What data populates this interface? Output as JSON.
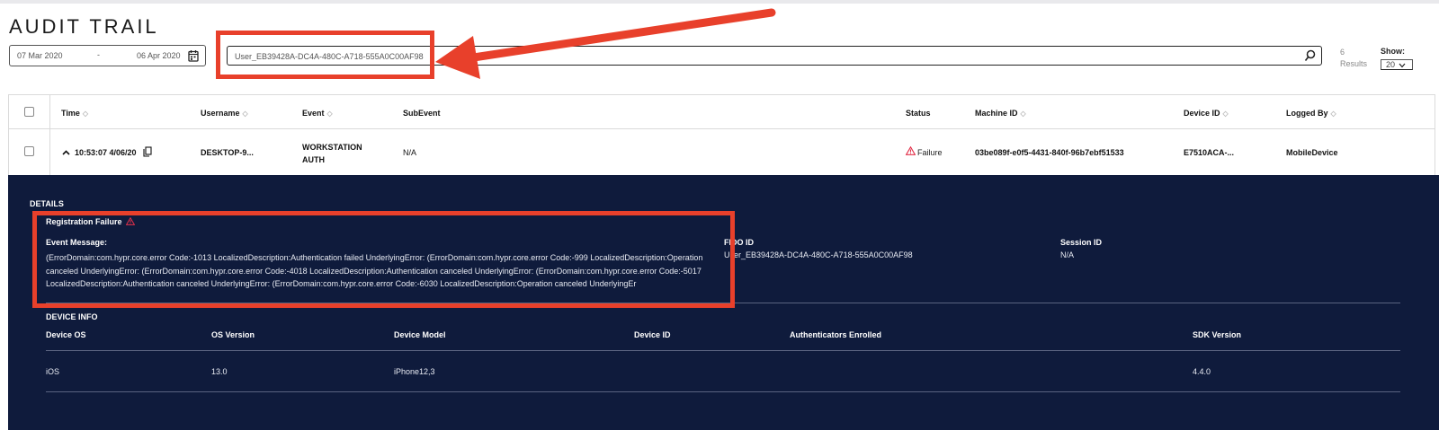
{
  "header": {
    "title": "AUDIT TRAIL"
  },
  "filters": {
    "date_start": "07 Mar 2020",
    "date_separator": "-",
    "date_end": "06 Apr 2020",
    "search_value": "User_EB39428A-DC4A-480C-A718-555A0C00AF98",
    "results_count": "6",
    "results_label": "Results",
    "show_label": "Show:",
    "show_value": "20"
  },
  "table": {
    "columns": [
      "Time",
      "Username",
      "Event",
      "SubEvent",
      "Status",
      "Machine ID",
      "Device ID",
      "Logged By"
    ],
    "row": {
      "time": "10:53:07 4/06/20",
      "username": "DESKTOP-9...",
      "event_line1": "WORKSTATION",
      "event_line2": "AUTH",
      "subevent": "N/A",
      "status": "Failure",
      "machine_id": "03be089f-e0f5-4431-840f-96b7ebf51533",
      "device_id": "E7510ACA-...",
      "logged_by": "MobileDevice"
    }
  },
  "details": {
    "section_title": "DETAILS",
    "failure_title": "Registration Failure",
    "event_message_label": "Event Message:",
    "event_message": "(ErrorDomain:com.hypr.core.error Code:-1013 LocalizedDescription:Authentication failed UnderlyingError: (ErrorDomain:com.hypr.core.error Code:-999 LocalizedDescription:Operation canceled UnderlyingError: (ErrorDomain:com.hypr.core.error Code:-4018 LocalizedDescription:Authentication canceled UnderlyingError: (ErrorDomain:com.hypr.core.error Code:-5017 LocalizedDescription:Authentication canceled UnderlyingError: (ErrorDomain:com.hypr.core.error Code:-6030 LocalizedDescription:Operation canceled UnderlyingEr",
    "fido_label": "FIDO ID",
    "fido_value": "User_EB39428A-DC4A-480C-A718-555A0C00AF98",
    "session_label": "Session ID",
    "session_value": "N/A",
    "device_info_title": "DEVICE INFO",
    "device_columns": [
      "Device OS",
      "OS Version",
      "Device Model",
      "Device ID",
      "Authenticators Enrolled",
      "SDK Version"
    ],
    "device_values": [
      "iOS",
      "13.0",
      "iPhone12,3",
      "",
      "",
      "4.4.0"
    ]
  },
  "colors": {
    "annotation_red": "#e8402b",
    "details_bg": "#0f1b3c",
    "warning": "#e2304a"
  },
  "icons": [
    "calendar-icon",
    "search-icon",
    "chevron-down-icon",
    "sort-icon",
    "chevron-up-icon",
    "copy-icon",
    "warning-icon"
  ]
}
